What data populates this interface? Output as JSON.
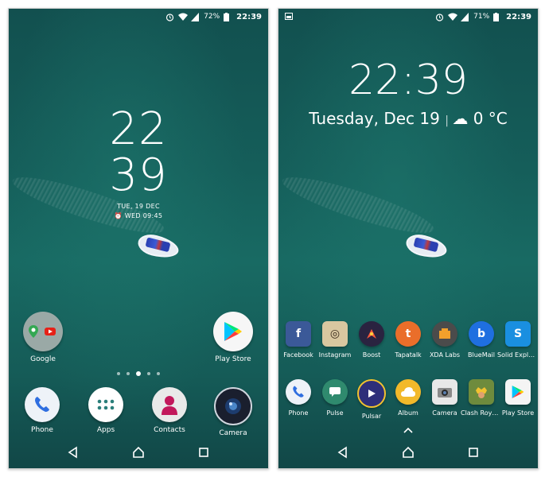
{
  "left_screen": {
    "status": {
      "battery": "72%",
      "time": "22:39"
    },
    "clock": {
      "hour": "22",
      "minute": "39",
      "date": "TUE, 19 DEC",
      "alarm": "WED 09:45"
    },
    "apps": [
      {
        "label": "Google",
        "icon": "google-folder-icon"
      },
      {
        "label": "Play Store",
        "icon": "play-store-icon"
      }
    ],
    "dock": [
      {
        "label": "Phone",
        "icon": "phone-icon"
      },
      {
        "label": "Apps",
        "icon": "apps-grid-icon"
      },
      {
        "label": "Contacts",
        "icon": "contacts-icon"
      },
      {
        "label": "Camera",
        "icon": "camera-icon"
      }
    ]
  },
  "right_screen": {
    "status": {
      "battery": "71%",
      "time": "22:39"
    },
    "clock": {
      "time": "22:39",
      "date": "Tuesday, Dec 19",
      "weather": "0 °C"
    },
    "row1": [
      {
        "label": "Facebook",
        "icon": "facebook-icon",
        "color": "#3b5998",
        "glyph": "f"
      },
      {
        "label": "Instagram",
        "icon": "instagram-icon",
        "color": "#d9c7a0",
        "glyph": "◎"
      },
      {
        "label": "Boost",
        "icon": "boost-icon",
        "color": "#2a2340",
        "glyph": "🚀"
      },
      {
        "label": "Tapatalk",
        "icon": "tapatalk-icon",
        "color": "#ea6e2a",
        "glyph": "t"
      },
      {
        "label": "XDA Labs",
        "icon": "xda-labs-icon",
        "color": "#5a5a5a",
        "glyph": "▣"
      },
      {
        "label": "BlueMail",
        "icon": "bluemail-icon",
        "color": "#1f6fe0",
        "glyph": "b"
      },
      {
        "label": "Solid Explo…",
        "icon": "solid-explorer-icon",
        "color": "#1a8fe0",
        "glyph": "S"
      }
    ],
    "row2": [
      {
        "label": "Phone",
        "icon": "phone-icon",
        "color": "#e8eef8",
        "glyph": "☎"
      },
      {
        "label": "Pulse",
        "icon": "pulse-icon",
        "color": "#2f8a6e",
        "glyph": "✉"
      },
      {
        "label": "Pulsar",
        "icon": "pulsar-icon",
        "color": "#3a3a8a",
        "glyph": "▶"
      },
      {
        "label": "Album",
        "icon": "album-icon",
        "color": "#f2b92a",
        "glyph": "☁"
      },
      {
        "label": "Camera",
        "icon": "camera-icon",
        "color": "#e8e8e8",
        "glyph": "◉"
      },
      {
        "label": "Clash Roya…",
        "icon": "clash-royale-icon",
        "color": "#5a7a3a",
        "glyph": "♛"
      },
      {
        "label": "Play Store",
        "icon": "play-store-icon",
        "color": "#f4f4f4",
        "glyph": "▶"
      }
    ]
  }
}
